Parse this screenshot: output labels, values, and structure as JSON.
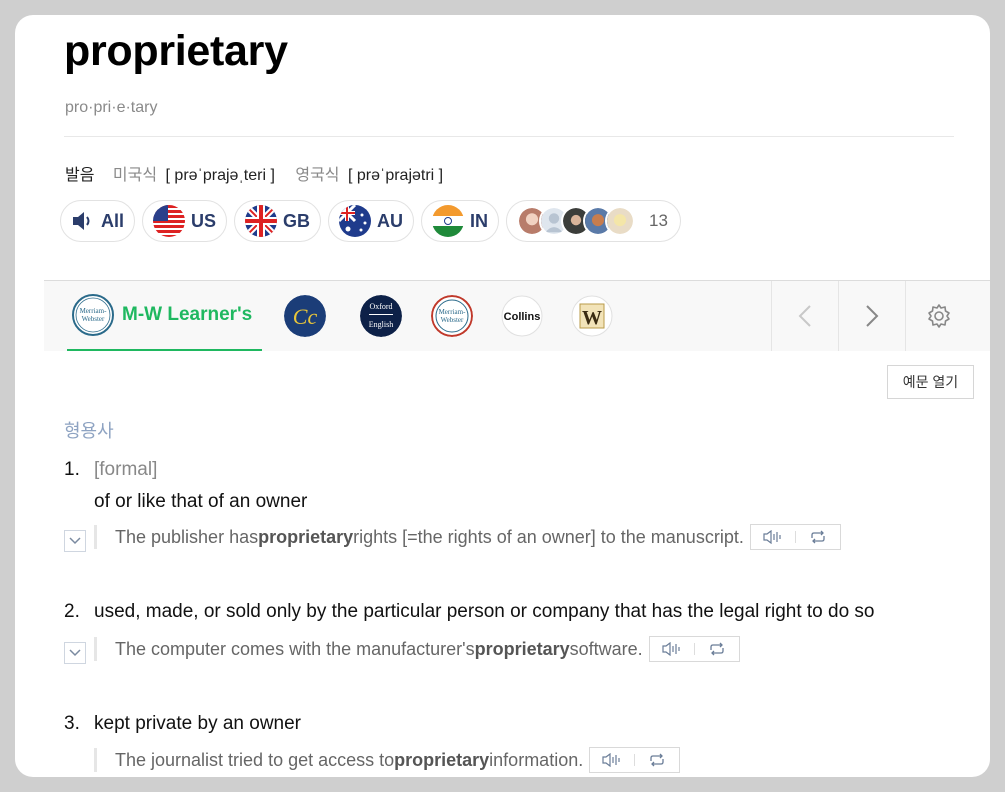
{
  "entry": {
    "headword": "proprietary",
    "syllabification": "pro·pri·e·tary"
  },
  "pronunciation": {
    "label": "발음",
    "us_label": "미국식",
    "us_ipa": "[ prəˈprajəˌteri ]",
    "uk_label": "영국식",
    "uk_ipa": "[ prəˈprajətri ]"
  },
  "audio": {
    "all": "All",
    "us": "US",
    "gb": "GB",
    "au": "AU",
    "in": "IN",
    "user_count": "13"
  },
  "dictionaries": {
    "active_label": "M-W Learner's",
    "icons": [
      "merriam-webster-learners",
      "collins-cobuild",
      "oxford-english",
      "merriam-webster",
      "collins",
      "wordnik"
    ],
    "collins_text": "Collins",
    "wordnik_text": "W",
    "oxford_text": "Oxford",
    "mw_text1": "Merriam-",
    "mw_text2": "Webster"
  },
  "example_toggle": "예문 열기",
  "part_of_speech": "형용사",
  "senses": [
    {
      "num": "1.",
      "grammar": "[formal]",
      "definition": "of or like that of an owner",
      "example_pre": "The publisher has ",
      "example_bold": "proprietary",
      "example_post": " rights [=the rights of an owner] to the manuscript."
    },
    {
      "num": "2.",
      "definition": "used, made, or sold only by the particular person or company that has the legal right to do so",
      "example_pre": "The computer comes with the manufacturer's ",
      "example_bold": "proprietary",
      "example_post": " software."
    },
    {
      "num": "3.",
      "definition": "kept private by an owner",
      "example_pre": "The journalist tried to get access to ",
      "example_bold": "proprietary",
      "example_post": " information."
    }
  ],
  "colors": {
    "accent_green": "#1fb860",
    "pos_blue": "#8ea3c2",
    "audio_navy": "#2b3d6b"
  }
}
